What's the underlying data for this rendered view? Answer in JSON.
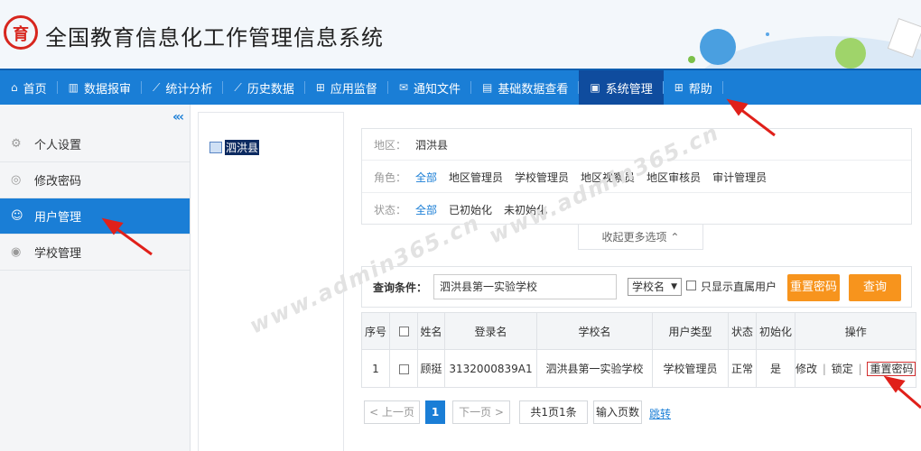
{
  "app": {
    "title": "全国教育信息化工作管理信息系统",
    "logo_text": "育"
  },
  "nav": [
    {
      "icon": "home-icon",
      "glyph": "⌂",
      "label": "首页"
    },
    {
      "icon": "bar-chart-icon",
      "glyph": "▥",
      "label": "数据报审"
    },
    {
      "icon": "line-chart-icon",
      "glyph": "⟋",
      "label": "统计分析"
    },
    {
      "icon": "history-chart-icon",
      "glyph": "⟋",
      "label": "历史数据"
    },
    {
      "icon": "grid-icon",
      "glyph": "⊞",
      "label": "应用监督"
    },
    {
      "icon": "mail-icon",
      "glyph": "✉",
      "label": "通知文件"
    },
    {
      "icon": "database-icon",
      "glyph": "▤",
      "label": "基础数据查看"
    },
    {
      "icon": "monitor-icon",
      "glyph": "▣",
      "label": "系统管理",
      "active": true
    },
    {
      "icon": "help-grid-icon",
      "glyph": "⊞",
      "label": "帮助"
    }
  ],
  "sidebar": {
    "collapse_glyph": "«‹",
    "items": [
      {
        "icon": "gear-icon",
        "glyph": "⚙",
        "label": "个人设置"
      },
      {
        "icon": "lock-icon",
        "glyph": "◎",
        "label": "修改密码"
      },
      {
        "icon": "users-icon",
        "glyph": "☺",
        "label": "用户管理",
        "active": true
      },
      {
        "icon": "school-icon",
        "glyph": "◉",
        "label": "学校管理"
      }
    ]
  },
  "tree": {
    "root_label": "泗洪县"
  },
  "filters": {
    "region": {
      "label": "地区：",
      "value": "泗洪县"
    },
    "role": {
      "label": "角色：",
      "options": [
        "全部",
        "地区管理员",
        "学校管理员",
        "地区视察员",
        "地区审核员",
        "审计管理员"
      ]
    },
    "status": {
      "label": "状态：",
      "options": [
        "全部",
        "已初始化",
        "未初始化"
      ]
    },
    "collapse_label": "收起更多选项",
    "collapse_glyph": "⌃"
  },
  "query": {
    "label": "查询条件：",
    "input_value": "泗洪县第一实验学校",
    "select_value": "学校名",
    "select_arrow": "▼",
    "checkbox_label": "只显示直属用户",
    "reset_button": "重置密码",
    "search_button": "查询"
  },
  "table": {
    "headers": [
      "序号",
      "",
      "姓名",
      "登录名",
      "学校名",
      "用户类型",
      "状态",
      "初始化",
      "操作"
    ],
    "rows": [
      {
        "no": "1",
        "name": "顾挺",
        "login": "3132000839A1",
        "school": "泗洪县第一实验学校",
        "type": "学校管理员",
        "status": "正常",
        "init": "是",
        "ops": {
          "edit": "修改",
          "sep1": "|",
          "lock": "锁定",
          "sep2": "|",
          "reset": "重置密码"
        }
      }
    ]
  },
  "pagination": {
    "prev": "< 上一页",
    "current": "1",
    "next": "下一页 >",
    "summary": "共1页1条",
    "input_placeholder": "输入页数",
    "jump": "跳转"
  },
  "watermark": "www.admin365.cn",
  "colors": {
    "primary": "#1a7ed6",
    "nav_active": "#0f4c9e",
    "orange": "#f7941d",
    "annotation_red": "#e0201a"
  }
}
